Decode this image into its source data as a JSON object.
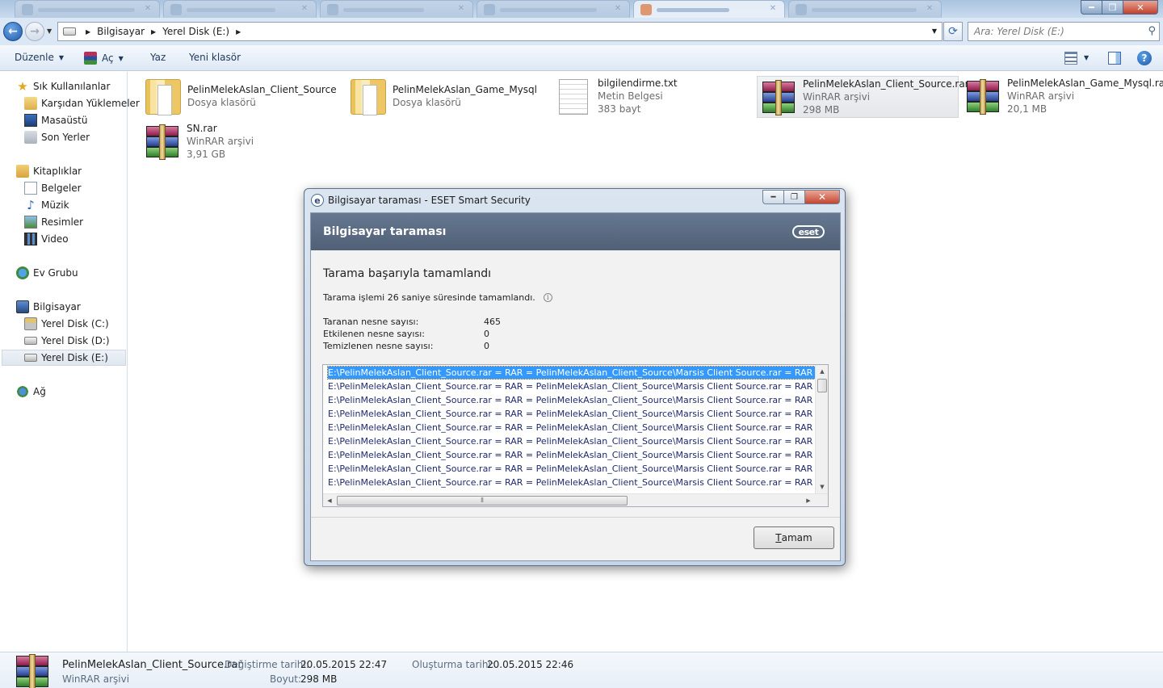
{
  "address": {
    "crumbs": [
      "Bilgisayar",
      "Yerel Disk (E:)"
    ],
    "search_placeholder": "Ara: Yerel Disk (E:)"
  },
  "commands": {
    "organize": "Düzenle",
    "open": "Aç",
    "burn": "Yaz",
    "new_folder": "Yeni klasör"
  },
  "nav": {
    "favorites": "Sık Kullanılanlar",
    "downloads": "Karşıdan Yüklemeler",
    "desktop": "Masaüstü",
    "recent": "Son Yerler",
    "libraries": "Kitaplıklar",
    "documents": "Belgeler",
    "music": "Müzik",
    "pictures": "Resimler",
    "video": "Video",
    "homegroup": "Ev Grubu",
    "computer": "Bilgisayar",
    "drive_c": "Yerel Disk (C:)",
    "drive_d": "Yerel Disk (D:)",
    "drive_e": "Yerel Disk (E:)",
    "network": "Ağ"
  },
  "files": [
    {
      "name": "PelinMelekAslan_Client_Source",
      "type": "Dosya klasörü",
      "size": "",
      "icon": "folder-icon"
    },
    {
      "name": "PelinMelekAslan_Game_Mysql",
      "type": "Dosya klasörü",
      "size": "",
      "icon": "folder-icon"
    },
    {
      "name": "bilgilendirme.txt",
      "type": "Metin Belgesi",
      "size": "383 bayt",
      "icon": "text-file-icon"
    },
    {
      "name": "PelinMelekAslan_Client_Source.rar",
      "type": "WinRAR arşivi",
      "size": "298 MB",
      "icon": "winrar-icon"
    },
    {
      "name": "PelinMelekAslan_Game_Mysql.rar",
      "type": "WinRAR arşivi",
      "size": "20,1 MB",
      "icon": "winrar-icon"
    },
    {
      "name": "SN.rar",
      "type": "WinRAR arşivi",
      "size": "3,91 GB",
      "icon": "winrar-icon"
    }
  ],
  "details": {
    "name": "PelinMelekAslan_Client_Source.rar",
    "type": "WinRAR arşivi",
    "modified_label": "Değiştirme tarihi:",
    "modified": "20.05.2015 22:47",
    "size_label": "Boyut:",
    "size": "298 MB",
    "created_label": "Oluşturma tarihi:",
    "created": "20.05.2015 22:46"
  },
  "eset": {
    "window_title": "Bilgisayar taraması - ESET Smart Security",
    "header": "Bilgisayar taraması",
    "logo": "eset",
    "heading": "Tarama başarıyla tamamlandı",
    "subtext": "Tarama işlemi 26 saniye süresinde tamamlandı.",
    "stats": [
      {
        "label": "Taranan nesne sayısı:",
        "value": "465"
      },
      {
        "label": "Etkilenen nesne sayısı:",
        "value": "0"
      },
      {
        "label": "Temizlenen nesne sayısı:",
        "value": "0"
      }
    ],
    "log": [
      "E:\\PelinMelekAslan_Client_Source.rar = RAR = PelinMelekAslan_Client_Source\\Marsis Client Source.rar = RAR = lib\\air",
      "E:\\PelinMelekAslan_Client_Source.rar = RAR = PelinMelekAslan_Client_Source\\Marsis Client Source.rar = RAR = lib\\ate",
      "E:\\PelinMelekAslan_Client_Source.rar = RAR = PelinMelekAslan_Client_Source\\Marsis Client Source.rar = RAR = lib\\ba",
      "E:\\PelinMelekAslan_Client_Source.rar = RAR = PelinMelekAslan_Client_Source\\Marsis Client Source.rar = RAR = lib\\co",
      "E:\\PelinMelekAslan_Client_Source.rar = RAR = PelinMelekAslan_Client_Source\\Marsis Client Source.rar = RAR = lib\\de",
      "E:\\PelinMelekAslan_Client_Source.rar = RAR = PelinMelekAslan_Client_Source\\Marsis Client Source.rar = RAR = lib\\dis",
      "E:\\PelinMelekAslan_Client_Source.rar = RAR = PelinMelekAslan_Client_Source\\Marsis Client Source.rar = RAR = lib\\ele",
      "E:\\PelinMelekAslan_Client_Source.rar = RAR = PelinMelekAslan_Client_Source\\Marsis Client Source.rar = RAR = lib\\ftp",
      "E:\\PelinMelekAslan_Client_Source.rar = RAR = PelinMelekAslan_Client_Source\\Marsis Client Source.rar = RAR = lib\\ga"
    ],
    "ok_prefix": "T",
    "ok_rest": "amam"
  },
  "colors": {
    "selection_blue": "#3399ff",
    "eset_header": "#5a6b82",
    "log_text": "#1f2a6e"
  }
}
